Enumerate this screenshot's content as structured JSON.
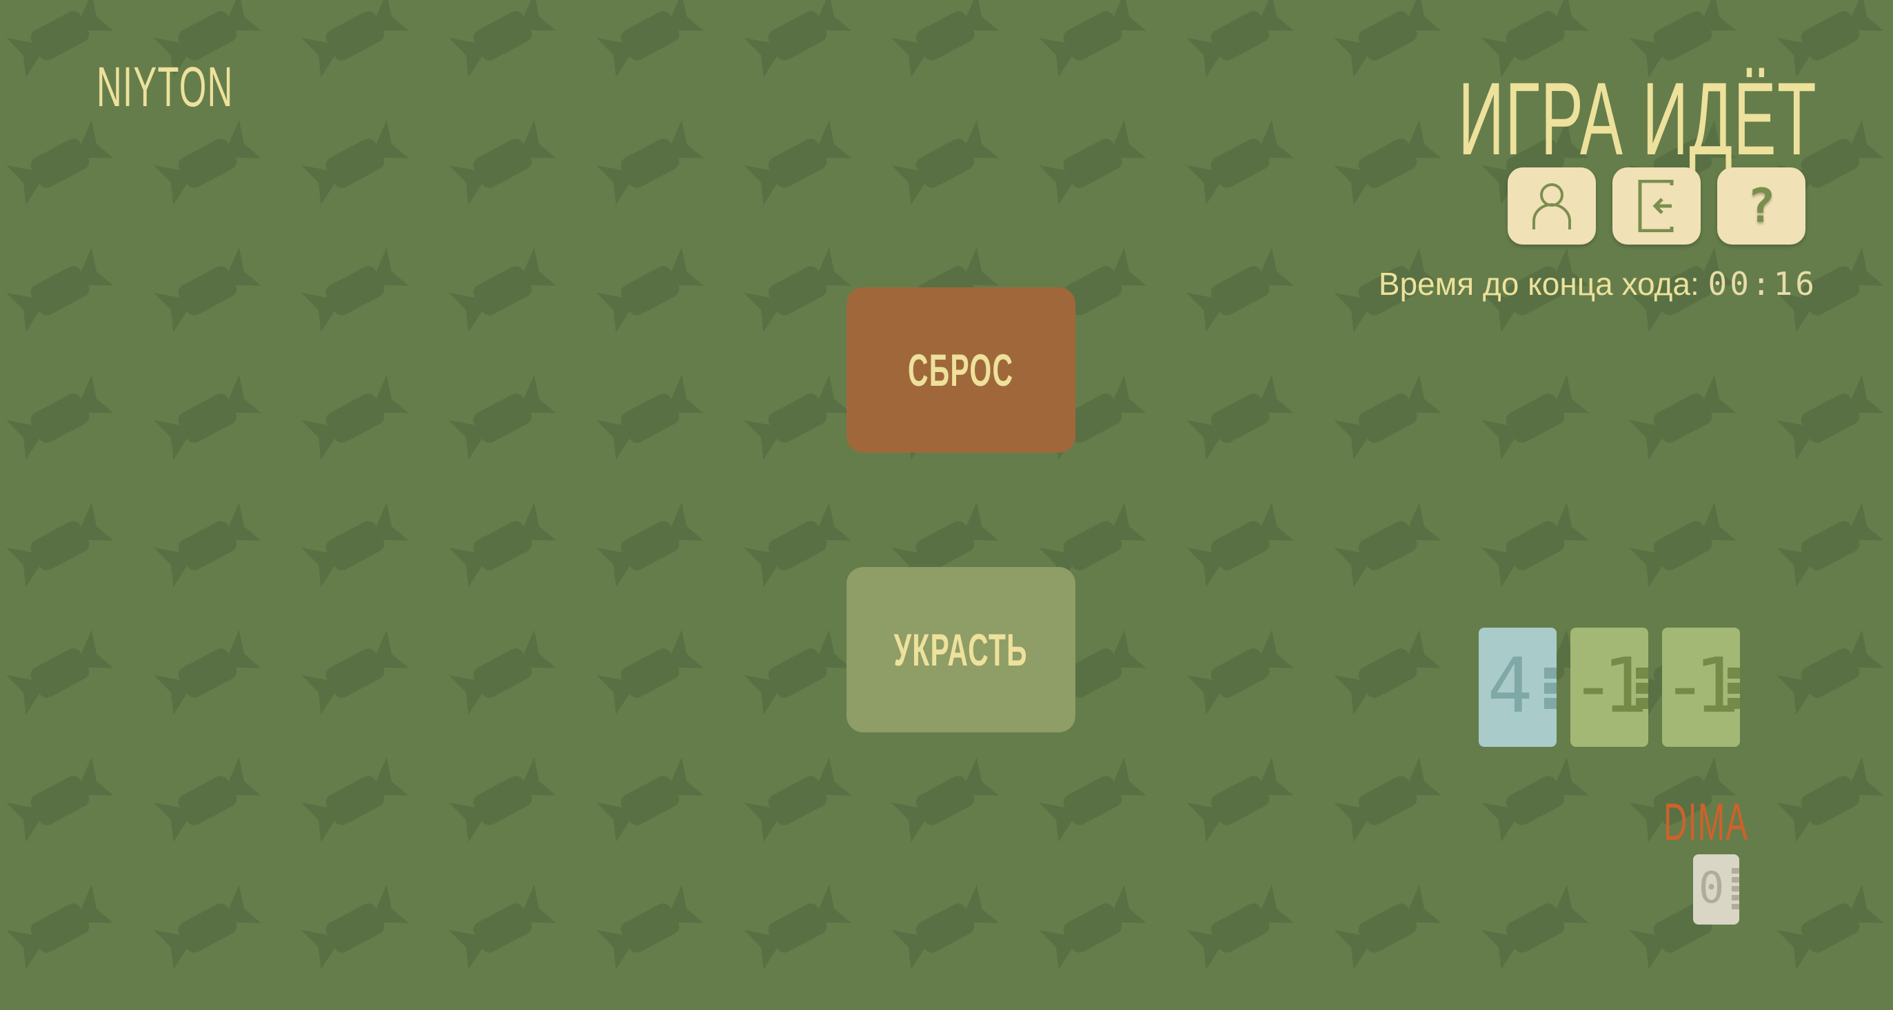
{
  "header": {
    "logo": "NIYTON",
    "status_title": "ИГРА ИДЁТ",
    "buttons": [
      {
        "icon": "user-icon"
      },
      {
        "icon": "exit-icon"
      },
      {
        "icon": "help-icon",
        "label": "?"
      }
    ],
    "timer_label": "Время до конца хода:",
    "timer_value": "00:16"
  },
  "actions": {
    "discard_label": "СБРОС",
    "steal_label": "УКРАСТЬ"
  },
  "table_cards": [
    {
      "value": "4",
      "color": "#a9cccb",
      "ink": "#7fa8a6"
    },
    {
      "value": "-1",
      "color": "#a3b874",
      "ink": "#758a48"
    },
    {
      "value": "-1",
      "color": "#a3b874",
      "ink": "#758a48"
    }
  ],
  "player": {
    "name": "DIMA",
    "card_value": "0"
  },
  "colors": {
    "background": "#657d4a",
    "accent_text": "#ede19c",
    "discard_button": "#a0683a",
    "steal_button": "#8f9d66",
    "player_name": "#cf612b"
  }
}
